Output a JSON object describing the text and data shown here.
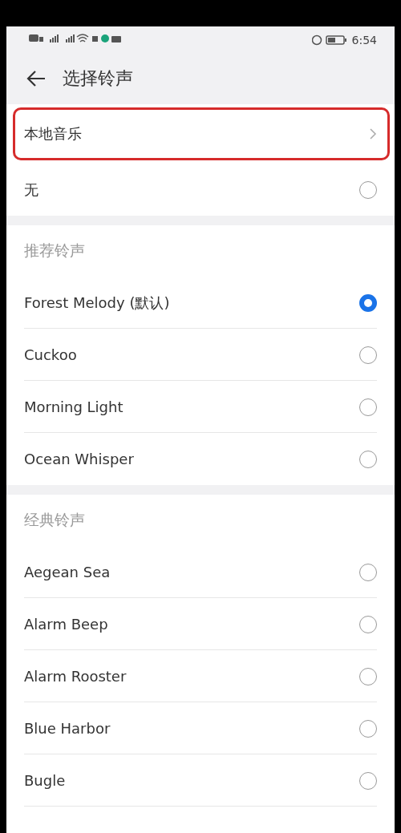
{
  "status_bar": {
    "time": "6:54"
  },
  "header": {
    "title": "选择铃声"
  },
  "local_music": {
    "label": "本地音乐",
    "highlighted": true
  },
  "none_option": {
    "label": "无",
    "selected": false
  },
  "sections": [
    {
      "title": "推荐铃声",
      "items": [
        {
          "label": "Forest Melody (默认)",
          "selected": true
        },
        {
          "label": "Cuckoo",
          "selected": false
        },
        {
          "label": "Morning Light",
          "selected": false
        },
        {
          "label": "Ocean Whisper",
          "selected": false
        }
      ]
    },
    {
      "title": "经典铃声",
      "items": [
        {
          "label": "Aegean Sea",
          "selected": false
        },
        {
          "label": "Alarm Beep",
          "selected": false
        },
        {
          "label": "Alarm Rooster",
          "selected": false
        },
        {
          "label": "Blue Harbor",
          "selected": false
        },
        {
          "label": "Bugle",
          "selected": false
        }
      ]
    }
  ]
}
